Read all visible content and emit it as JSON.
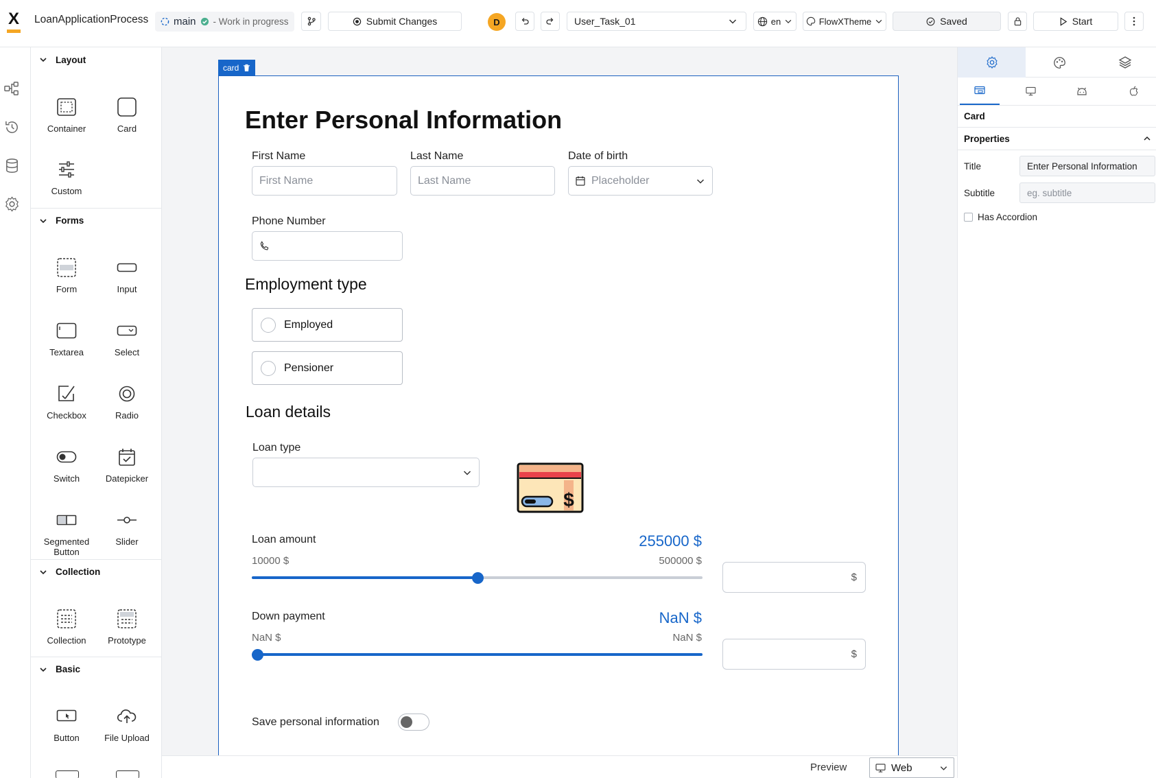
{
  "topbar": {
    "app_title": "LoanApplicationProcess",
    "branch": "main",
    "branch_status": "- Work in progress",
    "submit_label": "Submit Changes",
    "avatar_initial": "D",
    "task_select": "User_Task_01",
    "language": "en",
    "theme": "FlowXTheme",
    "saved_label": "Saved",
    "start_label": "Start"
  },
  "rail": {
    "icons": [
      "process-icon",
      "history-icon",
      "database-icon",
      "settings-icon"
    ]
  },
  "palette": {
    "layout": {
      "title": "Layout",
      "items": [
        "Container",
        "Card",
        "Custom"
      ]
    },
    "forms": {
      "title": "Forms",
      "items": [
        "Form",
        "Input",
        "Textarea",
        "Select",
        "Checkbox",
        "Radio",
        "Switch",
        "Datepicker",
        "Segmented Button",
        "Slider"
      ]
    },
    "collection": {
      "title": "Collection",
      "items": [
        "Collection",
        "Prototype"
      ]
    },
    "basic": {
      "title": "Basic",
      "items": [
        "Button",
        "File Upload"
      ]
    }
  },
  "canvas": {
    "card_tag": "card",
    "card_title": "Enter Personal Information",
    "first_name_label": "First Name",
    "first_name_placeholder": "First Name",
    "last_name_label": "Last Name",
    "last_name_placeholder": "Last Name",
    "dob_label": "Date of birth",
    "dob_placeholder": "Placeholder",
    "phone_label": "Phone Number",
    "employment_title": "Employment type",
    "employment_options": [
      "Employed",
      "Pensioner"
    ],
    "loan_details_title": "Loan details",
    "loan_type_label": "Loan type",
    "loan_type_value": "",
    "loan_amount": {
      "label": "Loan amount",
      "value": "255000 $",
      "min": "10000 $",
      "max": "500000 $",
      "fraction": 0.5,
      "suffix": "$"
    },
    "down_payment": {
      "label": "Down payment",
      "value": "NaN $",
      "min": "NaN $",
      "max": "NaN $",
      "fraction": 0,
      "suffix": "$"
    },
    "save_info_label": "Save personal information",
    "save_info_on": false
  },
  "preview": {
    "label": "Preview",
    "platform": "Web"
  },
  "inspector": {
    "tabs": [
      "settings-icon",
      "palette-icon",
      "layers-icon"
    ],
    "platforms": [
      "web-icon",
      "desktop-icon",
      "android-icon",
      "apple-icon"
    ],
    "component": "Card",
    "section": "Properties",
    "title_label": "Title",
    "title_value": "Enter Personal Information",
    "subtitle_label": "Subtitle",
    "subtitle_placeholder": "eg. subtitle",
    "accordion_label": "Has Accordion"
  },
  "colors": {
    "accent": "#1766c9",
    "logo_bar": "#f5a623",
    "avatar": "#f5a623"
  }
}
